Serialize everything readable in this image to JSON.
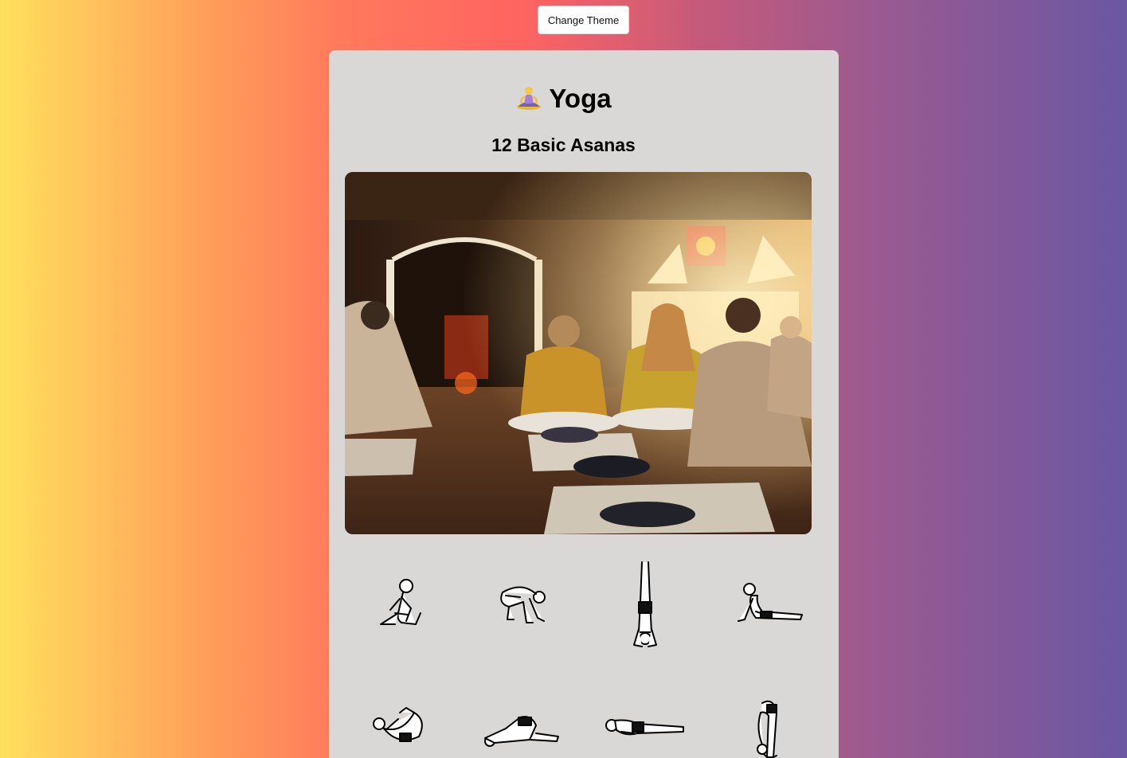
{
  "toolbar": {
    "theme_button_label": "Change Theme"
  },
  "header": {
    "emoji_icon": "person-in-lotus-position-icon",
    "title": "Yoga",
    "subtitle": "12 Basic Asanas"
  },
  "hero_image": {
    "icon": "yoga-class-photo"
  },
  "poses": [
    {
      "icon": "seated-twist-pose-icon"
    },
    {
      "icon": "crow-pose-icon"
    },
    {
      "icon": "headstand-pose-icon"
    },
    {
      "icon": "cobra-pose-icon"
    },
    {
      "icon": "bow-pose-icon"
    },
    {
      "icon": "locust-pose-icon"
    },
    {
      "icon": "corpse-pose-icon"
    },
    {
      "icon": "standing-forward-bend-icon"
    }
  ],
  "colors": {
    "gradient_start": "#ffe05d",
    "gradient_mid": "#ff6461",
    "gradient_end": "#6a57a3",
    "card_bg": "#d9d8d7"
  }
}
